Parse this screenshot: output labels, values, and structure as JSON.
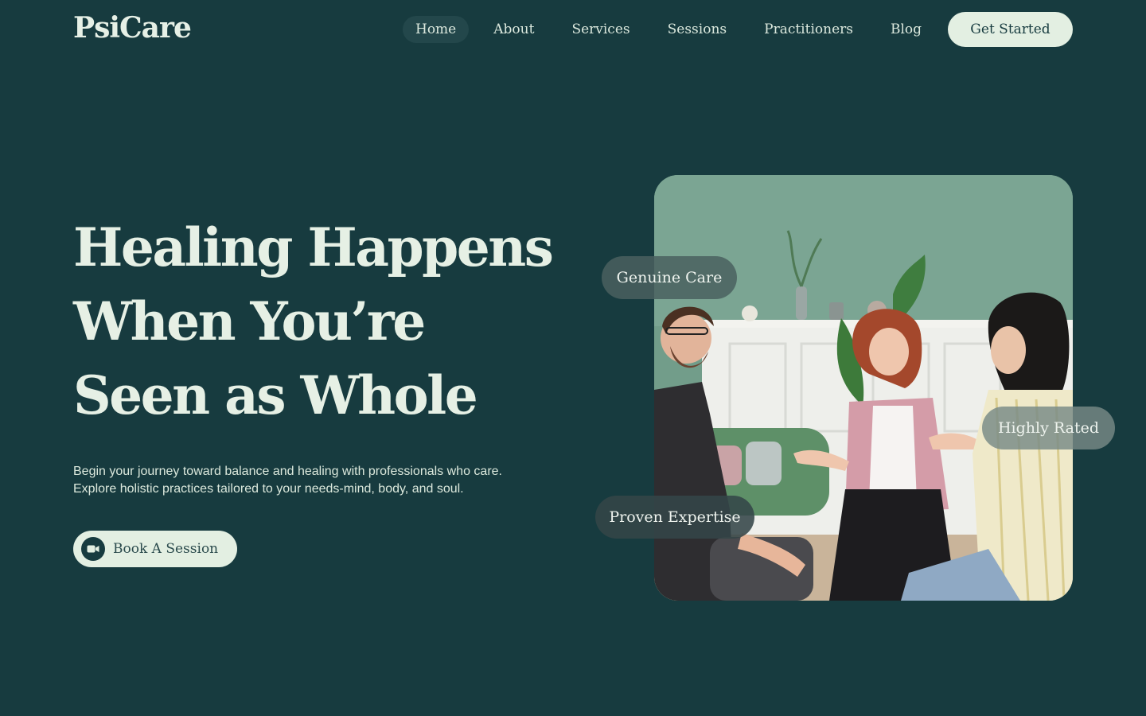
{
  "brand": {
    "logo": "PsiCare"
  },
  "nav": {
    "items": [
      {
        "label": "Home",
        "active": true
      },
      {
        "label": "About"
      },
      {
        "label": "Services"
      },
      {
        "label": "Sessions"
      },
      {
        "label": "Practitioners"
      },
      {
        "label": "Blog"
      }
    ],
    "cta_label": "Get Started"
  },
  "hero": {
    "title_lines": [
      "Healing Happens",
      "When You’re",
      "Seen as Whole"
    ],
    "description_lines": [
      "Begin your journey toward balance and healing with professionals who care.",
      "Explore holistic practices tailored to your needs-mind, body, and soul."
    ],
    "book_button_label": "Book A Session",
    "book_button_icon": "video-camera-icon"
  },
  "image": {
    "badges": {
      "genuine_care": "Genuine Care",
      "highly_rated": "Highly Rated",
      "proven_expertise": "Proven Expertise"
    }
  },
  "colors": {
    "background": "#173b3f",
    "text_light": "#e6f0e5",
    "button_bg": "#e3efe2",
    "nav_active_bg": "#23474b"
  }
}
